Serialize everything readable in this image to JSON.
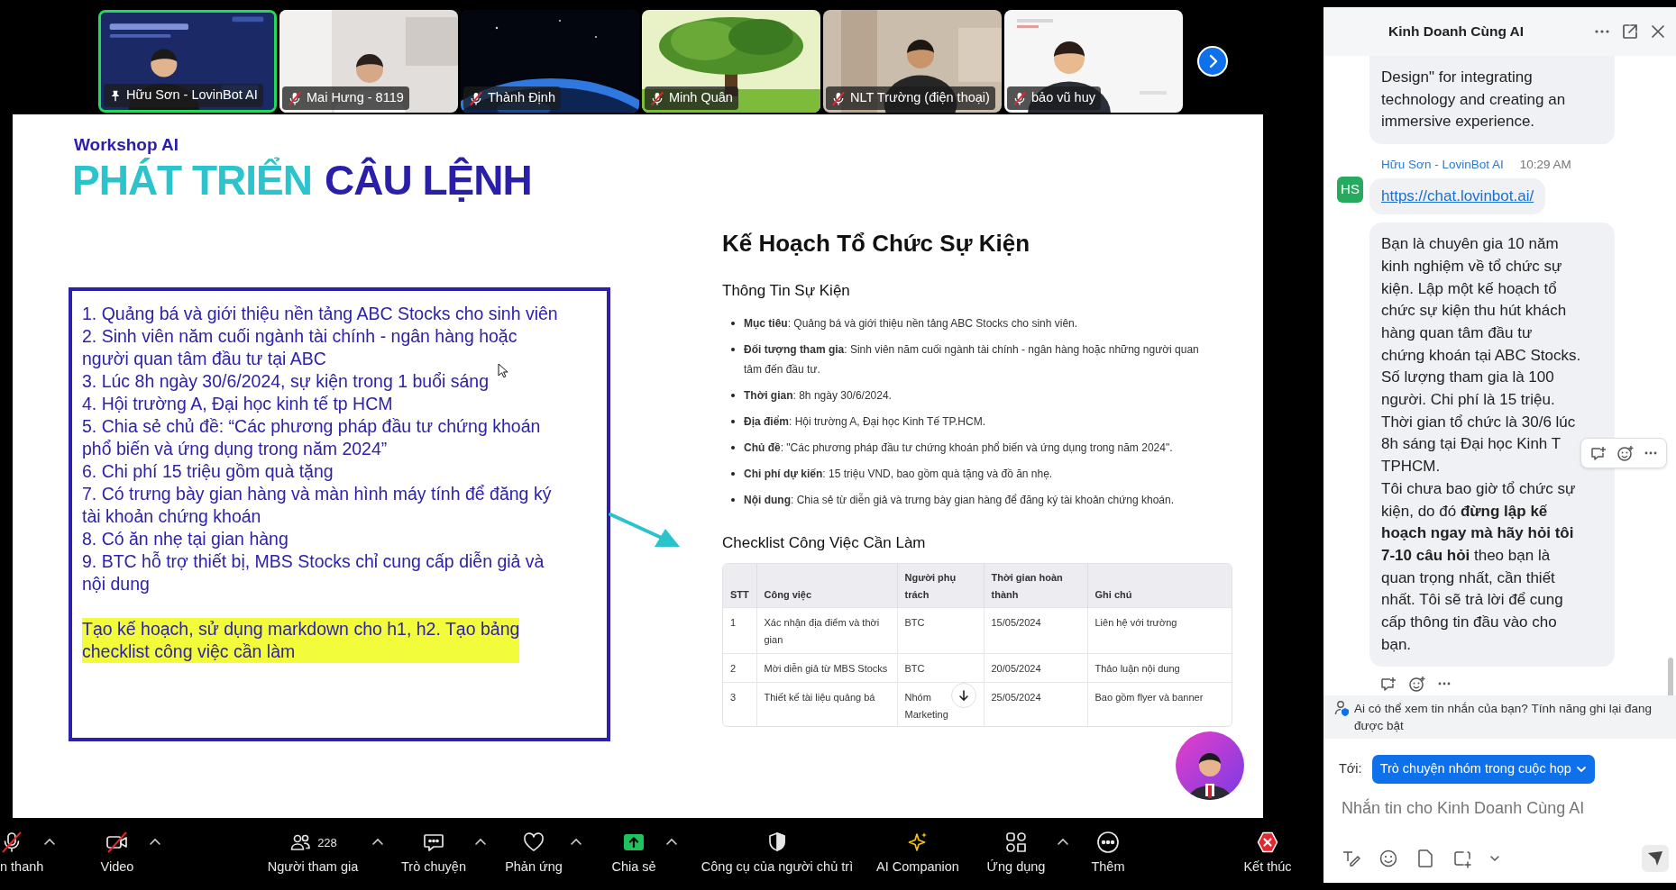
{
  "meeting_strip": {
    "tiles": [
      {
        "name": "Hữu Sơn - LovinBot AI",
        "pinned": true,
        "muted": false,
        "speaking": true
      },
      {
        "name": "Mai Hưng - 8119",
        "pinned": false,
        "muted": true,
        "speaking": false
      },
      {
        "name": "Thành Định",
        "pinned": false,
        "muted": true,
        "speaking": false
      },
      {
        "name": "Minh Quân",
        "pinned": false,
        "muted": true,
        "speaking": false
      },
      {
        "name": "NLT Trường (điện thoại)",
        "pinned": false,
        "muted": true,
        "speaking": false
      },
      {
        "name": "bảo vũ huy",
        "pinned": false,
        "muted": true,
        "speaking": false
      }
    ]
  },
  "slide": {
    "subtitle": "Workshop AI",
    "title": [
      {
        "text": "PHÁT TRIỂN",
        "color": "#2cc4cc"
      },
      {
        "text": "CÂU LỆNH",
        "color": "#2a1fa8"
      }
    ],
    "prompt_items": [
      "1. Quảng bá và giới thiệu nền tảng ABC Stocks cho sinh viên",
      "2. Sinh viên năm cuối ngành tài chính - ngân hàng hoặc\nngười quan tâm đầu tư tại ABC",
      "3. Lúc 8h ngày 30/6/2024, sự kiện trong 1 buổi sáng",
      "4. Hội trường A, Đại học kinh tế tp HCM",
      "5. Chia sẻ chủ đề: “Các phương pháp đầu tư chứng khoán\nphổ biến và ứng dụng trong năm 2024”",
      "6. Chi phí 15 triệu gồm quà tặng",
      "7. Có trưng bày gian hàng và màn hình máy tính để đăng ký\ntài khoản chứng khoán",
      "8. Có ăn nhẹ tại gian hàng",
      "9. BTC hỗ trợ thiết bị, MBS Stocks chỉ cung cấp diễn giả và\nnội dung"
    ],
    "prompt_instruction": "Tạo kế hoạch, sử dụng markdown cho h1, h2. Tạo bảng\nchecklist công việc cần làm",
    "plan": {
      "title": "Kế Hoạch Tổ Chức Sự Kiện",
      "info_heading": "Thông Tin Sự Kiện",
      "info_items": [
        "**Mục tiêu**: Quảng bá và giới thiệu nền tảng ABC Stocks cho sinh viên.",
        "**Đối tượng tham gia**: Sinh viên năm cuối ngành tài chính - ngân hàng hoặc những người quan\ntâm đến đầu tư.",
        "**Thời gian**: 8h ngày 30/6/2024.",
        "**Địa điểm**: Hội trường A, Đại học Kinh Tế TP.HCM.",
        "**Chủ đề**: \"Các phương pháp đầu tư chứng khoán phổ biến và ứng dụng trong năm 2024\".",
        "**Chi phí dự kiến**: 15 triệu VND, bao gồm quà tặng và đồ ăn nhẹ.",
        "**Nội dung**: Chia sẻ từ diễn giả và trưng bày gian hàng để đăng ký tài khoản chứng khoán."
      ],
      "checklist_heading": "Checklist Công Việc Cần Làm",
      "table": {
        "columns": [
          "STT",
          "Công việc",
          "Người phụ\ntrách",
          "Thời gian hoàn\nthành",
          "Ghi chú"
        ],
        "rows": [
          [
            "1",
            "Xác nhận địa điểm và thời\ngian",
            "BTC",
            "15/05/2024",
            "Liên hệ với trường"
          ],
          [
            "2",
            "Mời diễn giả từ MBS Stocks",
            "BTC",
            "20/05/2024",
            "Thảo luận nội dung"
          ],
          [
            "3",
            "Thiết kế tài liệu quảng bá",
            "Nhóm\nMarketing",
            "25/05/2024",
            "Bao gồm flyer và banner"
          ]
        ]
      }
    }
  },
  "toolbar": [
    {
      "kind": "audio",
      "label": "n thanh",
      "muted": true,
      "caret": true
    },
    {
      "kind": "video",
      "label": "Video",
      "muted": true,
      "caret": true
    },
    {
      "kind": "participants",
      "label": "Người tham gia",
      "count": "228",
      "muted": false,
      "caret": true
    },
    {
      "kind": "chat",
      "label": "Trò chuyện",
      "muted": false,
      "caret": true
    },
    {
      "kind": "reactions",
      "label": "Phản ứng",
      "muted": false,
      "caret": true
    },
    {
      "kind": "share",
      "label": "Chia sẻ",
      "muted": false,
      "caret": true
    },
    {
      "kind": "host",
      "label": "Công cụ của người chủ trì",
      "muted": false,
      "caret": false
    },
    {
      "kind": "ai",
      "label": "AI Companion",
      "muted": false,
      "caret": false
    },
    {
      "kind": "apps",
      "label": "Ứng dụng",
      "muted": false,
      "caret": true
    },
    {
      "kind": "more",
      "label": "Thêm",
      "muted": false,
      "caret": false
    },
    {
      "kind": "end",
      "label": "Kết thúc",
      "muted": false,
      "caret": false
    }
  ],
  "chat": {
    "title": "Kinh Doanh Cùng AI",
    "groups": [
      {
        "bubbles": [
          {
            "kind": "text",
            "text": "Design\" for integrating\ntechnology and creating an\nimmersive experience.",
            "hovered": false
          }
        ]
      },
      {
        "sender": "Hữu Sơn - LovinBot AI",
        "time": "10:29 AM",
        "avatar": "HS",
        "bubbles": [
          {
            "kind": "link",
            "text": "https://chat.lovinbot.ai/",
            "hovered": false
          },
          {
            "kind": "text",
            "text": "Bạn là chuyên gia 10 năm\nkinh nghiệm về tổ chức sự\nkiện. Lập một kế hoạch tổ\nchức sự kiện thu hút khách\nhàng quan tâm đầu tư\nchứng khoán tại ABC Stocks.\nSố lượng tham gia là 100\nngười. Chi phí là 15 triệu.\nThời gian tổ chức là 30/6 lúc\n8h sáng tại Đại học Kinh T\nTPHCM.\nTôi chưa bao giờ tổ chức sự\nkiện, do đó **đừng lập kế**\n**hoạch ngay mà hãy hỏi tôi**\n**7-10 câu hỏi** theo bạn là\nquan trọng nhất, cần thiết\nnhất. Tôi sẽ trả lời để cung\ncấp thông tin đầu vào cho\nbạn.",
            "hovered": true
          }
        ]
      }
    ],
    "notice": "Ai có thể xem tin nhắn của bạn? Tính năng ghi lại đang\nđược bật",
    "recipient_label": "Tới:",
    "recipient": "Trò chuyện nhóm trong cuộc họp",
    "placeholder": "Nhắn tin cho Kinh Doanh Cùng AI"
  }
}
